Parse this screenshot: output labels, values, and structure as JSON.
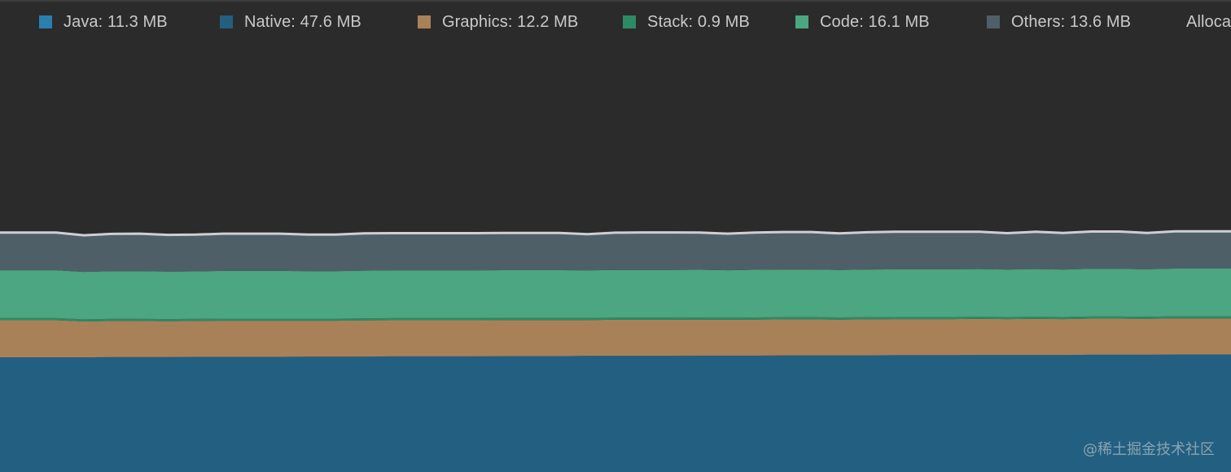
{
  "legend": [
    {
      "label": "Java: 11.3 MB",
      "color": "#2a7fae",
      "icon": "square-swatch"
    },
    {
      "label": "Native: 47.6 MB",
      "color": "#245f80",
      "icon": "square-swatch"
    },
    {
      "label": "Graphics: 12.2 MB",
      "color": "#a98159",
      "icon": "square-swatch"
    },
    {
      "label": "Stack: 0.9 MB",
      "color": "#2c8a66",
      "icon": "square-swatch"
    },
    {
      "label": "Code: 16.1 MB",
      "color": "#4ba681",
      "icon": "square-swatch"
    },
    {
      "label": "Others: 13.6 MB",
      "color": "#4f5f68",
      "icon": "square-swatch"
    },
    {
      "label": "Alloca",
      "color": "",
      "icon": ""
    }
  ],
  "watermark": "@稀土掘金技术社区",
  "chart_data": {
    "type": "area",
    "stacked": true,
    "grid": false,
    "legend_position": "top",
    "ylim": [
      0,
      200
    ],
    "x": [
      0,
      1,
      2,
      3,
      4,
      5,
      6,
      7,
      8,
      9,
      10,
      11,
      12,
      13,
      14,
      15,
      16,
      17,
      18,
      19,
      20,
      21,
      22,
      23,
      24,
      25,
      26,
      27,
      28,
      29,
      30,
      31,
      32,
      33,
      34,
      35,
      36,
      37,
      38,
      39,
      40,
      41,
      42,
      43,
      44
    ],
    "series": [
      {
        "name": "Native",
        "color": "#235f80",
        "values": [
          48.6,
          48.6,
          48.6,
          48.6,
          48.7,
          48.7,
          48.7,
          48.8,
          48.8,
          48.8,
          48.8,
          48.9,
          48.9,
          48.9,
          49.0,
          49.0,
          49.0,
          49.0,
          49.1,
          49.1,
          49.1,
          49.2,
          49.2,
          49.2,
          49.2,
          49.3,
          49.3,
          49.3,
          49.4,
          49.4,
          49.4,
          49.4,
          49.5,
          49.5,
          49.5,
          49.6,
          49.6,
          49.6,
          49.6,
          49.7,
          49.7,
          49.7,
          49.8,
          49.8,
          49.8
        ]
      },
      {
        "name": "Graphics",
        "color": "#a98159",
        "values": [
          15.7,
          15.7,
          15.7,
          15.2,
          15.3,
          15.3,
          15.2,
          15.2,
          15.3,
          15.3,
          15.3,
          15.2,
          15.2,
          15.3,
          15.3,
          15.3,
          15.3,
          15.3,
          15.3,
          15.3,
          15.3,
          15.2,
          15.3,
          15.3,
          15.3,
          15.3,
          15.2,
          15.3,
          15.3,
          15.3,
          15.2,
          15.3,
          15.3,
          15.3,
          15.3,
          15.3,
          15.2,
          15.3,
          15.2,
          15.3,
          15.3,
          15.2,
          15.3,
          15.3,
          15.3
        ]
      },
      {
        "name": "Stack",
        "color": "#2c8a66",
        "values": [
          0.9,
          0.9,
          0.9,
          0.9,
          0.9,
          0.9,
          0.9,
          0.9,
          0.9,
          0.9,
          0.9,
          0.9,
          0.9,
          0.9,
          0.9,
          0.9,
          0.9,
          0.9,
          0.9,
          0.9,
          0.9,
          0.9,
          0.9,
          0.9,
          0.9,
          0.9,
          0.9,
          0.9,
          0.9,
          0.9,
          0.9,
          0.9,
          0.9,
          0.9,
          0.9,
          0.9,
          0.9,
          0.9,
          0.9,
          0.9,
          0.9,
          0.9,
          0.9,
          0.9,
          0.9
        ]
      },
      {
        "name": "Code",
        "color": "#4ba681",
        "values": [
          20.3,
          20.3,
          20.3,
          20.1,
          20.2,
          20.2,
          20.1,
          20.1,
          20.2,
          20.2,
          20.2,
          20.1,
          20.1,
          20.2,
          20.2,
          20.2,
          20.2,
          20.2,
          20.2,
          20.2,
          20.2,
          20.1,
          20.2,
          20.2,
          20.2,
          20.2,
          20.1,
          20.2,
          20.2,
          20.2,
          20.1,
          20.2,
          20.2,
          20.2,
          20.2,
          20.2,
          20.1,
          20.2,
          20.1,
          20.2,
          20.2,
          20.1,
          20.2,
          20.2,
          20.2
        ]
      },
      {
        "name": "Others",
        "color": "#4f5f68",
        "values": [
          16.0,
          16.0,
          16.0,
          15.5,
          15.8,
          15.9,
          15.6,
          15.6,
          15.8,
          15.8,
          15.8,
          15.5,
          15.5,
          15.8,
          15.8,
          15.8,
          15.8,
          15.8,
          15.8,
          15.8,
          15.8,
          15.4,
          15.8,
          15.9,
          15.9,
          15.8,
          15.5,
          15.8,
          15.9,
          15.9,
          15.5,
          15.8,
          15.9,
          15.9,
          15.9,
          15.8,
          15.4,
          15.8,
          15.5,
          15.8,
          15.8,
          15.4,
          15.8,
          15.8,
          15.8
        ]
      }
    ],
    "total_line_color": "#cfcfcf"
  }
}
